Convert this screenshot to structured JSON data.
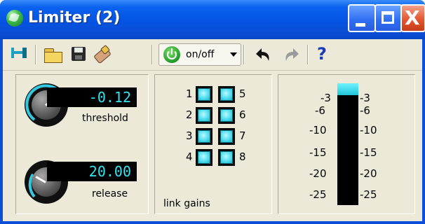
{
  "window": {
    "title": "Limiter (2)",
    "minimize_label": "",
    "maximize_label": "",
    "close_label": "X"
  },
  "toolbar": {
    "onoff_label": "on/off",
    "help_label": "?",
    "icons": [
      "pin-icon",
      "folder-icon",
      "save-icon",
      "eraser-icon",
      "power-icon",
      "dropdown-arrow-icon",
      "undo-icon",
      "redo-icon",
      "help-icon"
    ]
  },
  "controls": {
    "threshold": {
      "value": "-0.12",
      "label": "threshold"
    },
    "release": {
      "value": "20.00",
      "label": "release"
    }
  },
  "link_gains": {
    "title": "link gains",
    "channels": [
      "1",
      "2",
      "3",
      "4",
      "5",
      "6",
      "7",
      "8"
    ]
  },
  "meter": {
    "ticks": [
      "-3",
      "-6",
      "-10",
      "-15",
      "-20",
      "-25"
    ],
    "level_fraction": 0.1
  },
  "colors": {
    "title_bar": "#0553e2",
    "display_text": "#2fe6f2",
    "led": "#49d9ec"
  }
}
